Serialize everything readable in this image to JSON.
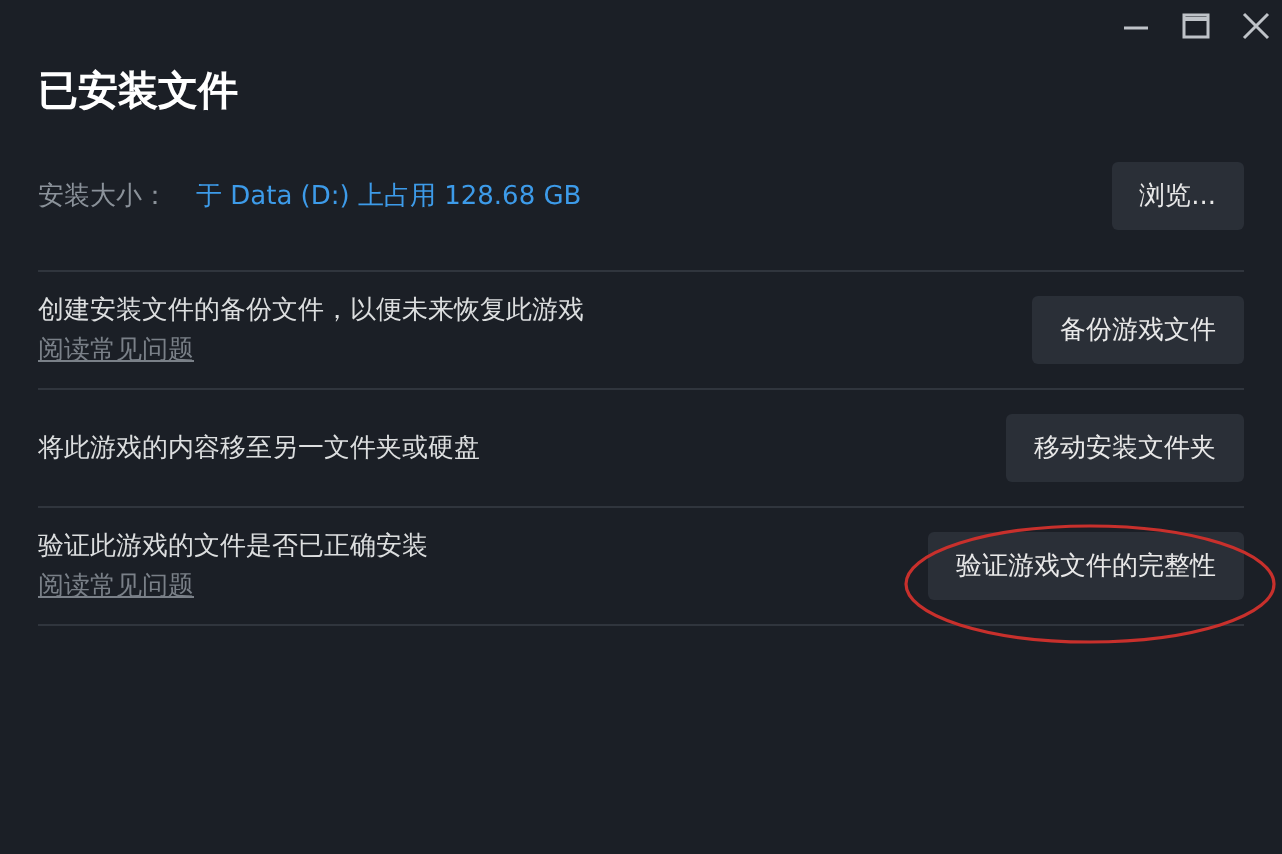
{
  "title": "已安装文件",
  "install_size": {
    "label": "安装大小：",
    "value": "于 Data (D:) 上占用 128.68 GB",
    "button": "浏览..."
  },
  "rows": [
    {
      "description": "创建安装文件的备份文件，以便未来恢复此游戏",
      "link": "阅读常见问题",
      "button": "备份游戏文件",
      "circled": false
    },
    {
      "description": "将此游戏的内容移至另一文件夹或硬盘",
      "button": "移动安装文件夹",
      "circled": false
    },
    {
      "description": "验证此游戏的文件是否已正确安装",
      "link": "阅读常见问题",
      "button": "验证游戏文件的完整性",
      "circled": true
    }
  ]
}
